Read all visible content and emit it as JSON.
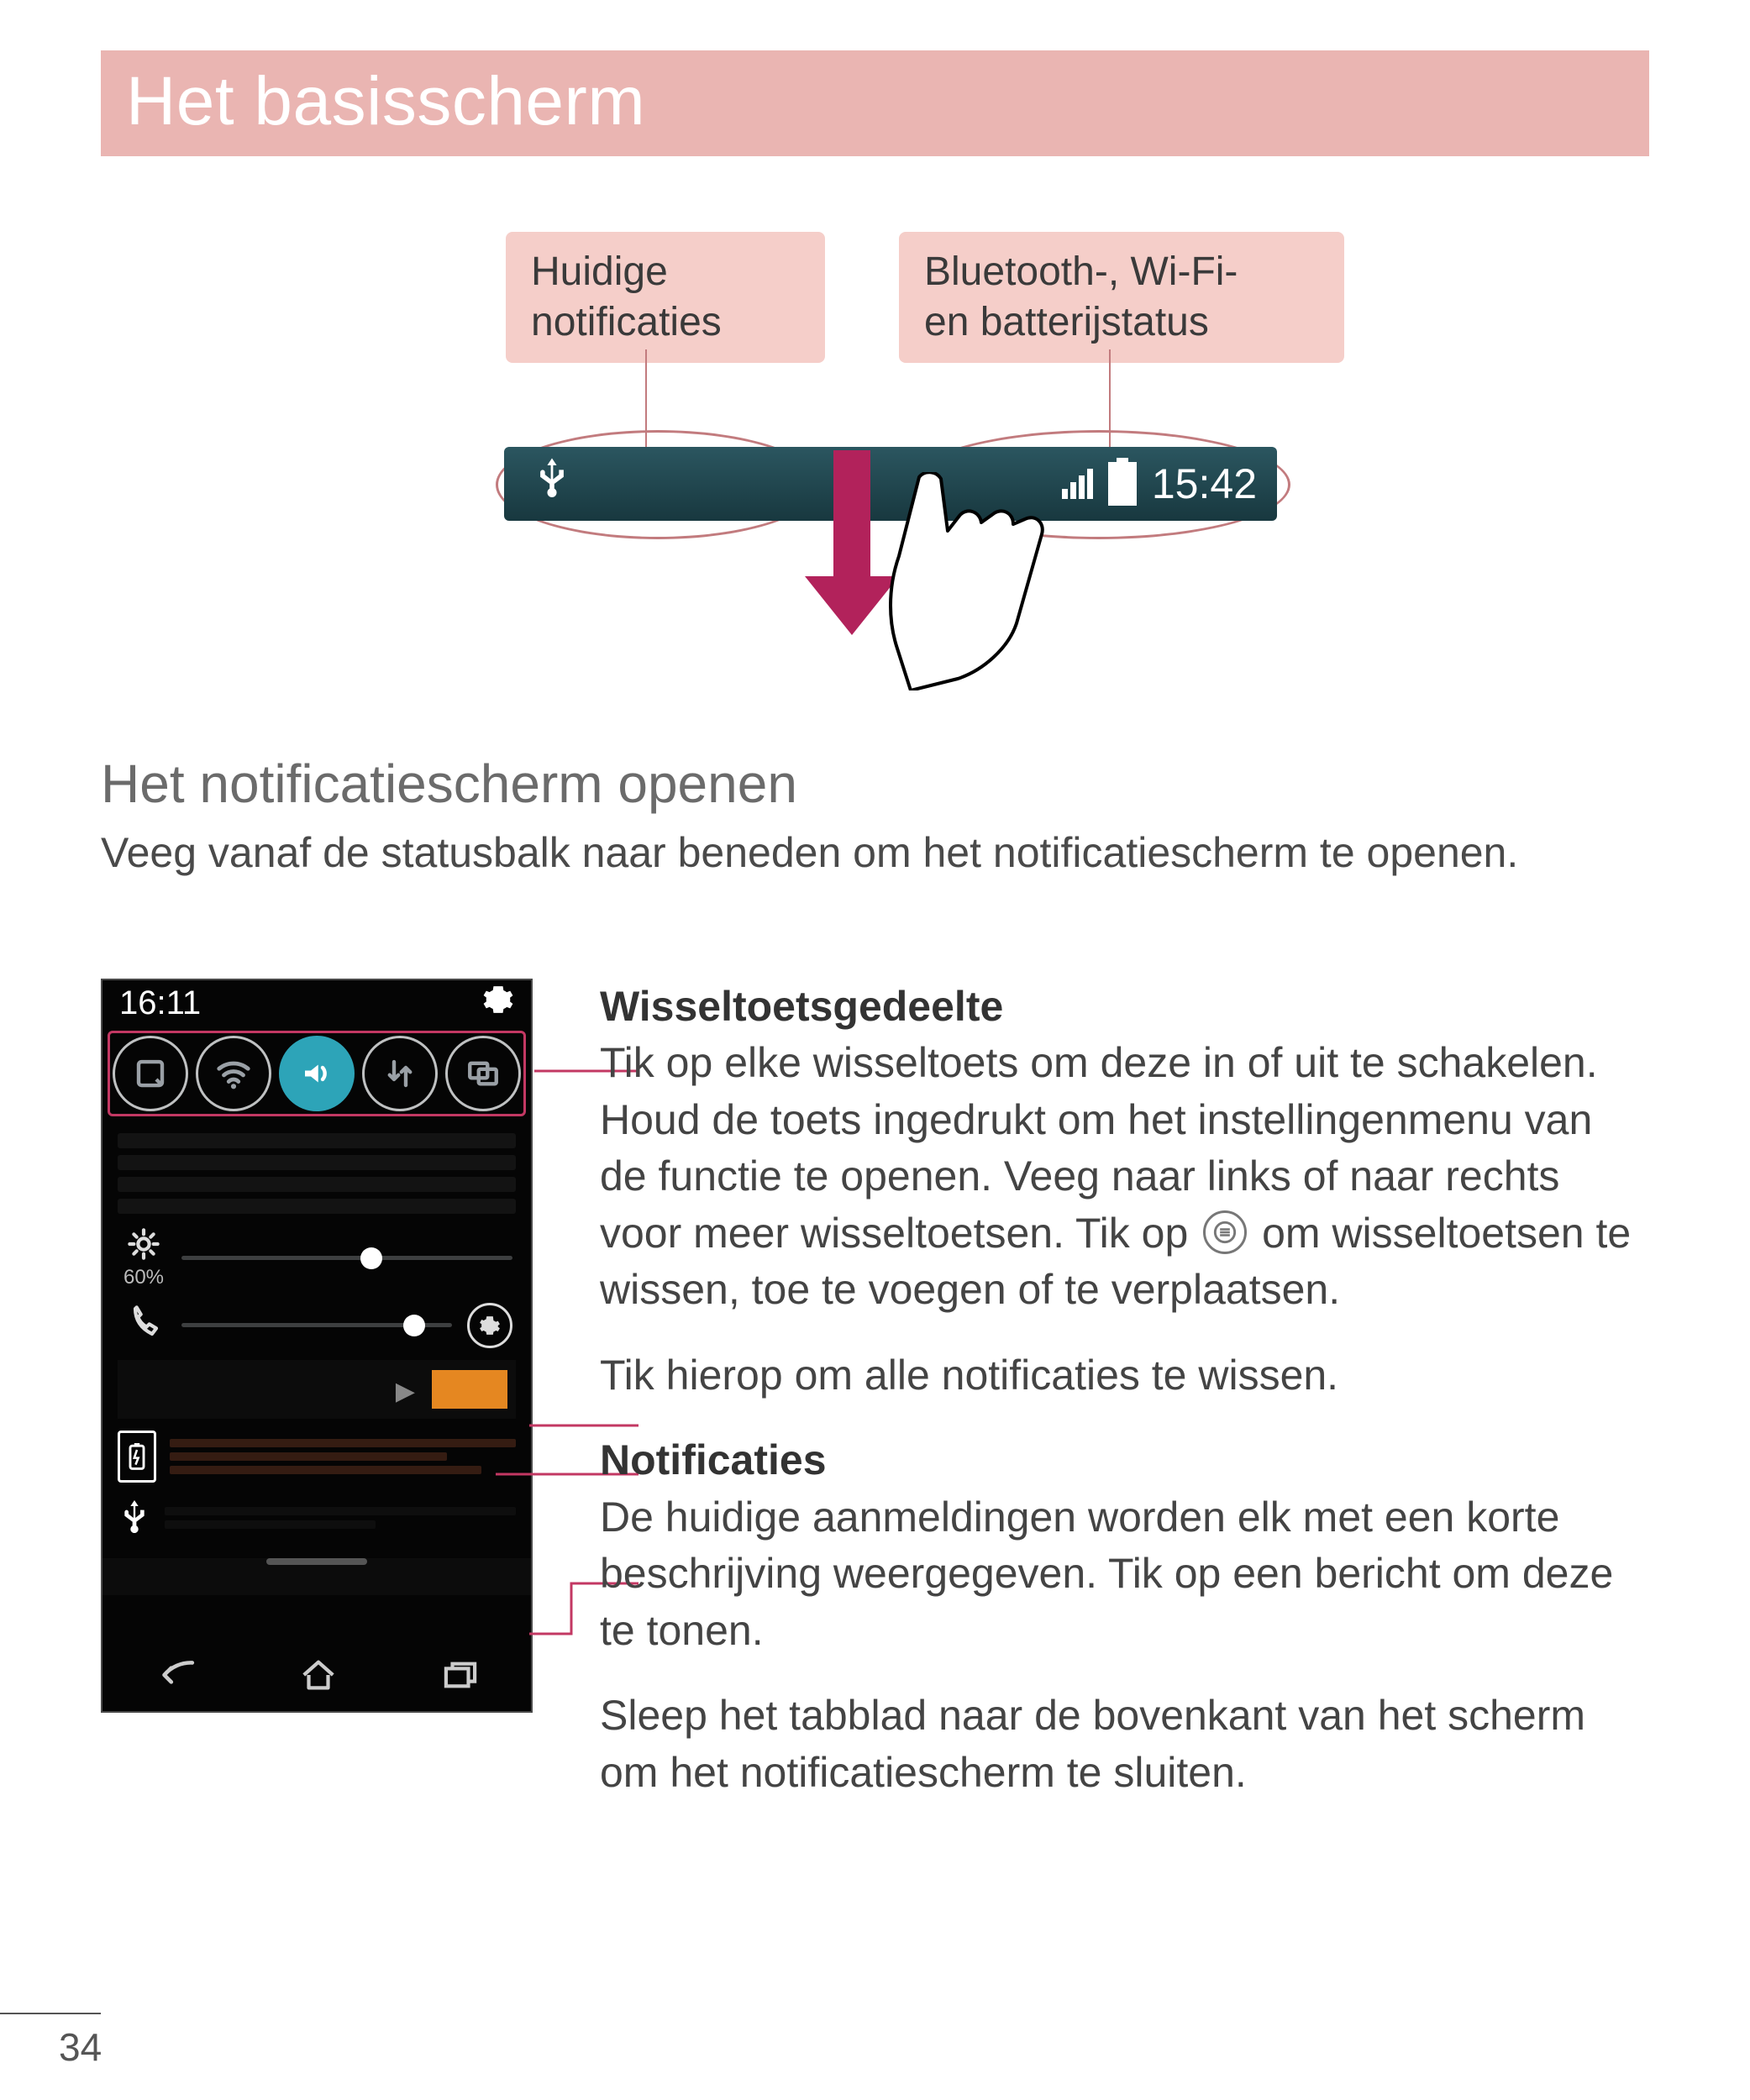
{
  "title": "Het basisscherm",
  "callouts": {
    "current_notifications": "Huidige\nnotificaties",
    "status_icons": "Bluetooth-, Wi-Fi-\nen batterijstatus"
  },
  "status_bar_preview": {
    "time": "15:42"
  },
  "section": {
    "heading": "Het notificatiescherm openen",
    "body": "Veeg vanaf de statusbalk naar beneden om het notificatiescherm te openen."
  },
  "phone": {
    "time": "16:11",
    "brightness_percent": "60%"
  },
  "explain": {
    "toggle_title": "Wisseltoetsgedeelte",
    "toggle_body_1": "Tik op elke wisseltoets om deze in of uit te schakelen. Houd de toets ingedrukt om het instellingenmenu van de functie te openen. Veeg naar links of naar rechts voor meer wisseltoetsen. Tik op ",
    "toggle_body_2": " om wisseltoetsen te wissen, toe te voegen of te verplaatsen.",
    "clear_all": "Tik hierop om alle notificaties te wissen.",
    "notif_title": "Notificaties",
    "notif_body": "De huidige aanmeldingen worden elk met een korte beschrijving weergegeven. Tik op een bericht om deze te tonen.",
    "close_body": "Sleep het tabblad naar de bovenkant van het scherm om het notificatiescherm te sluiten."
  },
  "page_number": "34"
}
